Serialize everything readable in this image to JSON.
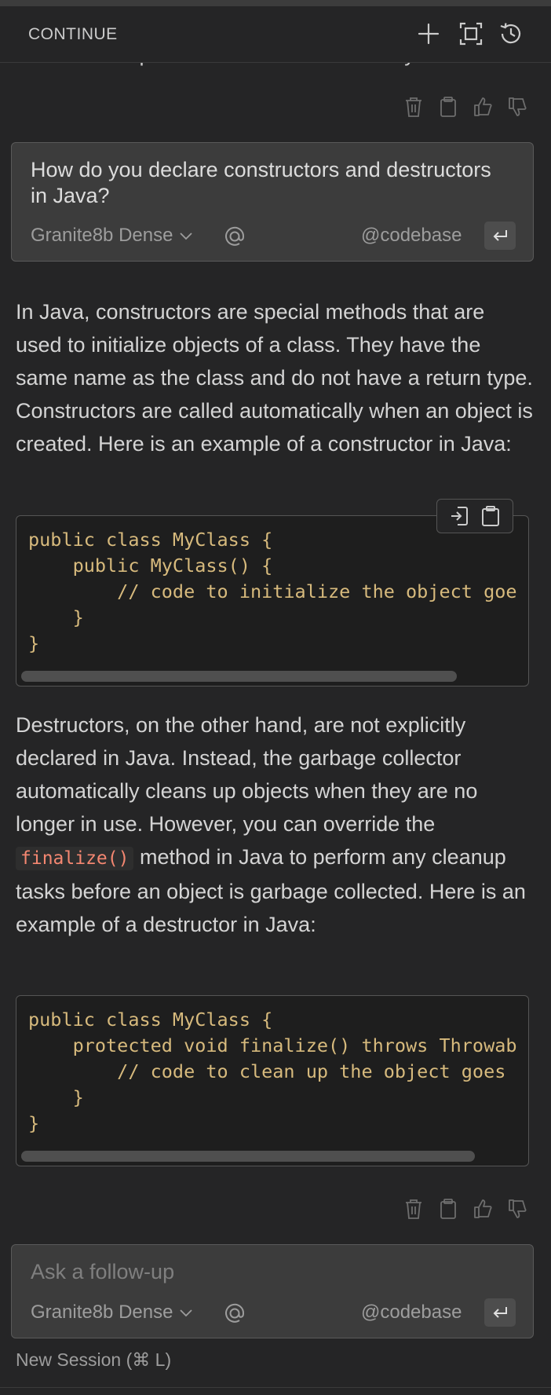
{
  "header": {
    "title": "CONTINUE"
  },
  "prev_response_tail": "middle list to produce the final sorted array.",
  "user_message": {
    "text": "How do you declare constructors and destructors in Java?",
    "model": "Granite8b Dense",
    "codebase": "@codebase"
  },
  "response": {
    "para1": "In Java, constructors are special methods that are used to initialize objects of a class. They have the same name as the class and do not have a return type. Constructors are called automatically when an object is created. Here is an example of a constructor in Java:",
    "code1": "public class MyClass {\n    public MyClass() {\n        // code to initialize the object goe\n    }\n}",
    "para2_a": "Destructors, on the other hand, are not explicitly declared in Java. Instead, the garbage collector automatically cleans up objects when they are no longer in use. However, you can override the",
    "para2_code": "finalize()",
    "para2_b": "method in Java to perform any cleanup tasks before an object is garbage collected. Here is an example of a destructor in Java:",
    "code2": "public class MyClass {\n    protected void finalize() throws Throwab\n        // code to clean up the object goes\n    }\n}"
  },
  "followup": {
    "placeholder": "Ask a follow-up",
    "model": "Granite8b Dense",
    "codebase": "@codebase"
  },
  "footer": {
    "new_session": "New Session (⌘ L)"
  },
  "colors": {
    "background": "#252526",
    "code_text": "#d7ba7d",
    "inline_code": "#f48771",
    "input_bg": "#3c3c3c"
  }
}
